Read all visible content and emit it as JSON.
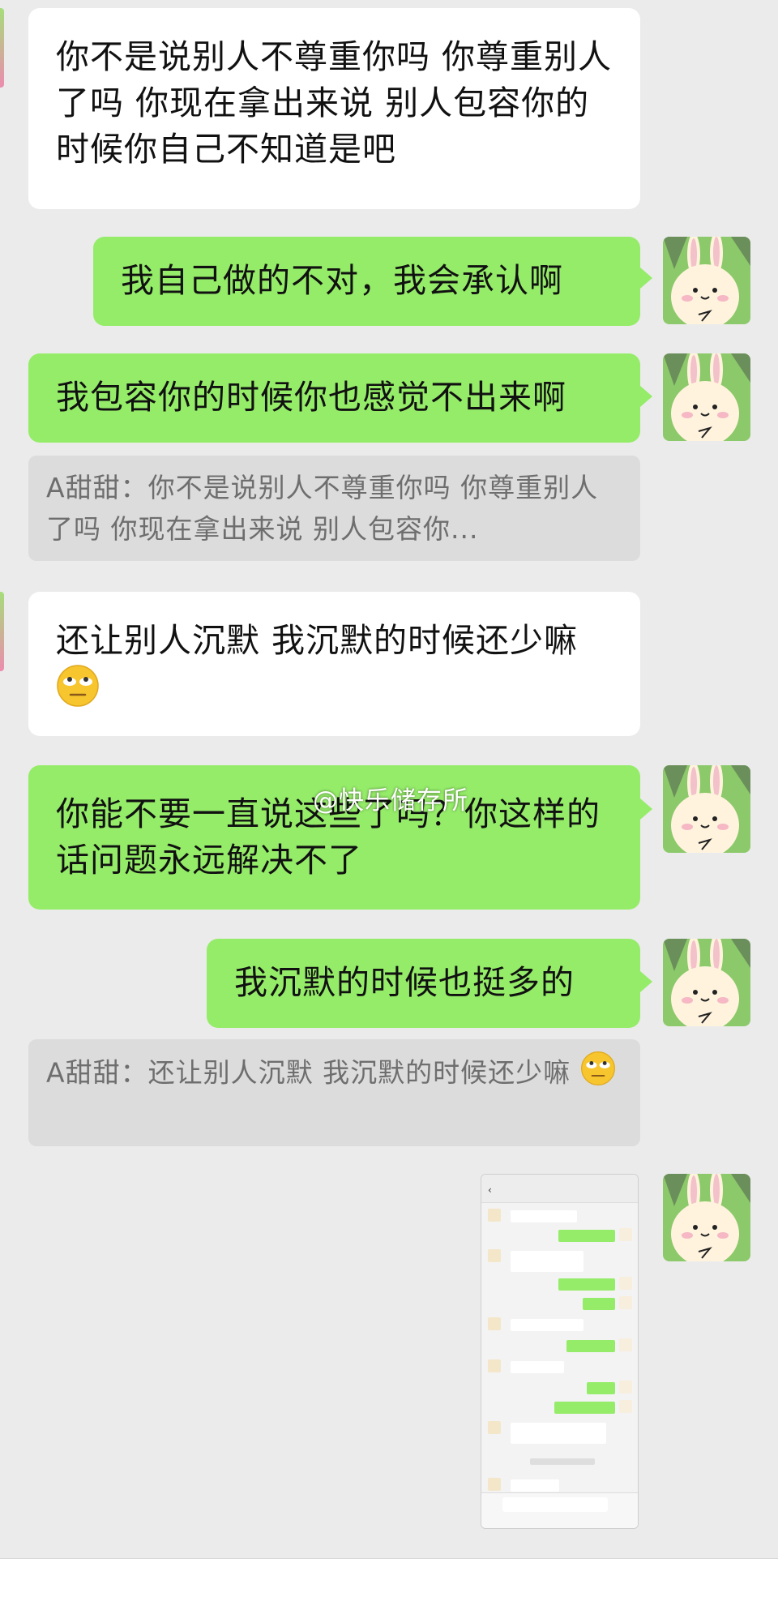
{
  "messages": [
    {
      "side": "left",
      "text": "你不是说别人不尊重你吗 你尊重别人了吗 你现在拿出来说 别人包容你的时候你自己不知道是吧"
    },
    {
      "side": "right",
      "text": "我自己做的不对，我会承认啊"
    },
    {
      "side": "right",
      "text": "我包容你的时候你也感觉不出来啊"
    },
    {
      "side": "quote",
      "text": "A甜甜：你不是说别人不尊重你吗 你尊重别人了吗 你现在拿出来说 别人包容你..."
    },
    {
      "side": "left",
      "text": "还让别人沉默 我沉默的时候还少嘛"
    },
    {
      "side": "right",
      "text": "你能不要一直说这些了吗？你这样的话问题永远解决不了"
    },
    {
      "side": "right",
      "text": "我沉默的时候也挺多的"
    },
    {
      "side": "quote",
      "text": "A甜甜：还让别人沉默 我沉默的时候还少嘛"
    }
  ],
  "watermark": "@快乐储存所",
  "icons": {
    "emoji": "eye-roll-emoji-icon",
    "avatar": "bunny-avatar-icon"
  },
  "colors": {
    "background": "#ebebeb",
    "self_bubble": "#95ec69",
    "other_bubble": "#ffffff",
    "quote_bg": "#dcdcdc",
    "quote_text": "#6e6e6e"
  }
}
